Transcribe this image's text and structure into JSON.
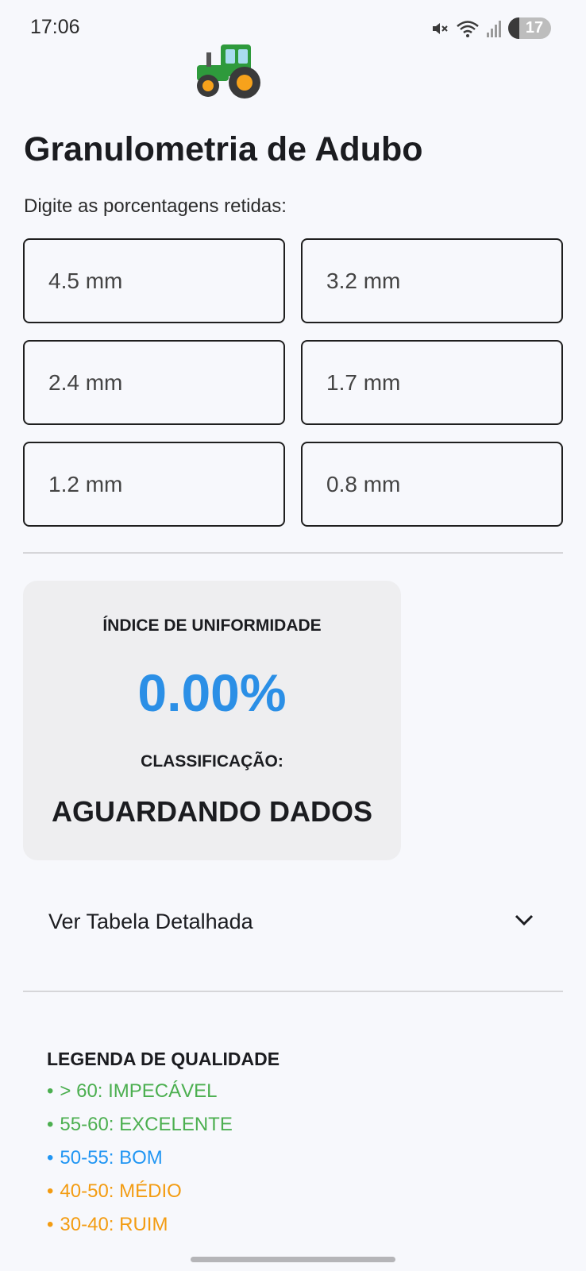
{
  "status_bar": {
    "time": "17:06",
    "battery": "17"
  },
  "title": "Granulometria de Adubo",
  "subtitle": "Digite as porcentagens retidas:",
  "fields": [
    {
      "placeholder": "4.5 mm"
    },
    {
      "placeholder": "3.2 mm"
    },
    {
      "placeholder": "2.4 mm"
    },
    {
      "placeholder": "1.7 mm"
    },
    {
      "placeholder": "1.2 mm"
    },
    {
      "placeholder": "0.8 mm"
    }
  ],
  "result": {
    "index_label": "ÍNDICE DE UNIFORMIDADE",
    "index_value": "0.00%",
    "class_label": "CLASSIFICAÇÃO:",
    "class_value": "AGUARDANDO DADOS"
  },
  "expander": {
    "label": "Ver Tabela Detalhada"
  },
  "legend": {
    "title": "LEGENDA DE QUALIDADE",
    "items": [
      {
        "text": "> 60: IMPECÁVEL",
        "color": "#4caf50"
      },
      {
        "text": "55-60: EXCELENTE",
        "color": "#4caf50"
      },
      {
        "text": "50-55: BOM",
        "color": "#2196f3"
      },
      {
        "text": "40-50: MÉDIO",
        "color": "#f39c12"
      },
      {
        "text": "30-40: RUIM",
        "color": "#f39c12"
      }
    ]
  },
  "colors": {
    "accent": "#2b8fe6",
    "background": "#f7f8fc",
    "card": "#eeeef0"
  },
  "icons": [
    "tractor-icon",
    "mute-icon",
    "wifi-icon",
    "signal-icon",
    "chevron-down-icon"
  ]
}
